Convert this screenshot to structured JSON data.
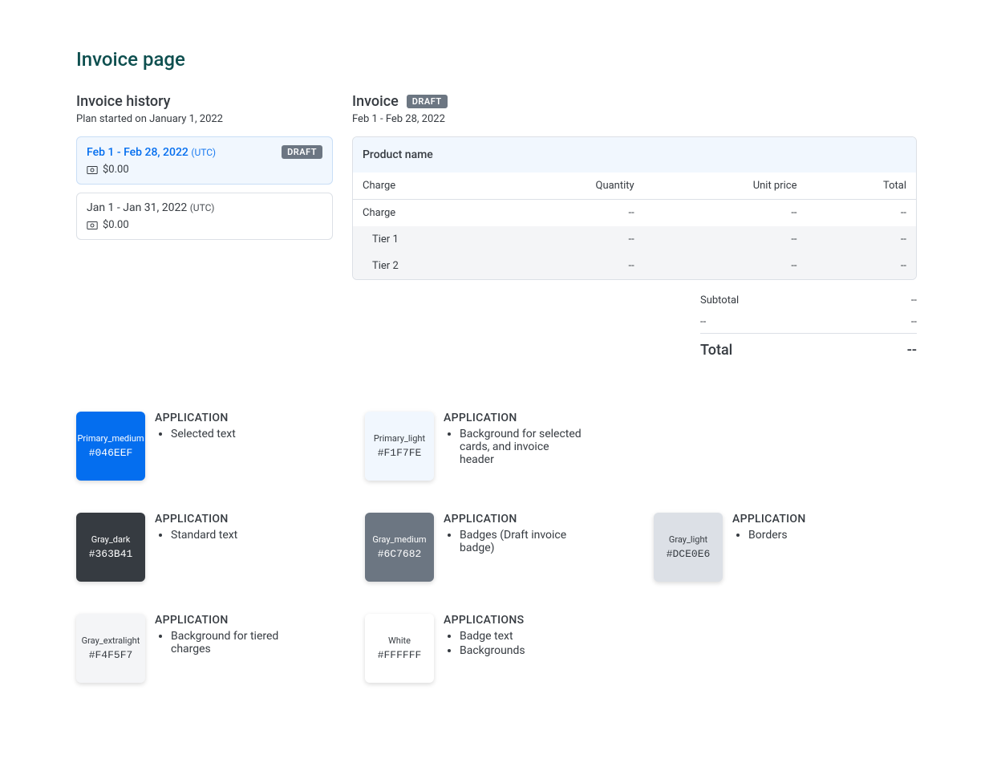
{
  "pageTitle": "Invoice page",
  "history": {
    "title": "Invoice history",
    "subtitle": "Plan started on January 1, 2022",
    "items": [
      {
        "dateRange": "Feb 1 - Feb 28, 2022",
        "tz": "(UTC)",
        "badge": "DRAFT",
        "amount": "$0.00",
        "selected": true
      },
      {
        "dateRange": "Jan 1 - Jan 31, 2022",
        "tz": "(UTC)",
        "badge": null,
        "amount": "$0.00",
        "selected": false
      }
    ]
  },
  "invoice": {
    "title": "Invoice",
    "badge": "DRAFT",
    "subtitle": "Feb 1 - Feb 28, 2022",
    "productHeader": "Product name",
    "columns": {
      "charge": "Charge",
      "quantity": "Quantity",
      "unitPrice": "Unit price",
      "total": "Total"
    },
    "rows": [
      {
        "label": "Charge",
        "quantity": "--",
        "unitPrice": "--",
        "total": "--",
        "tier": false
      },
      {
        "label": "Tier 1",
        "quantity": "--",
        "unitPrice": "--",
        "total": "--",
        "tier": true
      },
      {
        "label": "Tier 2",
        "quantity": "--",
        "unitPrice": "--",
        "total": "--",
        "tier": true
      }
    ],
    "totals": {
      "subtotalLabel": "Subtotal",
      "subtotalValue": "--",
      "blankLabel": "--",
      "blankValue": "--",
      "totalLabel": "Total",
      "totalValue": "--"
    }
  },
  "applicationLabel": "APPLICATION",
  "applicationsLabel": "APPLICATIONS",
  "swatches": {
    "primaryMedium": {
      "name": "Primary_medium",
      "hex": "#046EEF",
      "bg": "#046EEF",
      "fg": "#ffffff",
      "uses": [
        "Selected text"
      ]
    },
    "primaryLight": {
      "name": "Primary_light",
      "hex": "#F1F7FE",
      "bg": "#F1F7FE",
      "fg": "#363B41",
      "uses": [
        "Background for selected cards, and invoice header"
      ]
    },
    "grayDark": {
      "name": "Gray_dark",
      "hex": "#363B41",
      "bg": "#363B41",
      "fg": "#ffffff",
      "uses": [
        "Standard text"
      ]
    },
    "grayMedium": {
      "name": "Gray_medium",
      "hex": "#6C7682",
      "bg": "#6C7682",
      "fg": "#ffffff",
      "uses": [
        "Badges (Draft invoice badge)"
      ]
    },
    "grayLight": {
      "name": "Gray_light",
      "hex": "#DCE0E6",
      "bg": "#DCE0E6",
      "fg": "#363B41",
      "uses": [
        "Borders"
      ]
    },
    "grayExtralight": {
      "name": "Gray_extralight",
      "hex": "#F4F5F7",
      "bg": "#F4F5F7",
      "fg": "#363B41",
      "uses": [
        "Background for tiered charges"
      ]
    },
    "white": {
      "name": "White",
      "hex": "#FFFFFF",
      "bg": "#FFFFFF",
      "fg": "#363B41",
      "uses": [
        "Badge text",
        "Backgrounds"
      ]
    }
  }
}
